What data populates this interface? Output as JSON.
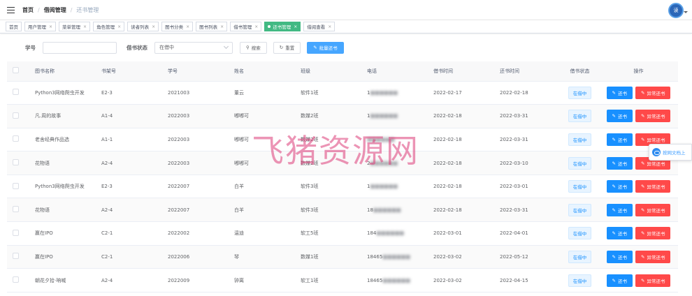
{
  "breadcrumb": [
    "首页",
    "借阅管理",
    "还书管理"
  ],
  "avatar_label": "读",
  "tabs": [
    {
      "label": "首页",
      "active": false,
      "closable": false
    },
    {
      "label": "用户管理",
      "active": false,
      "closable": true
    },
    {
      "label": "菜单管理",
      "active": false,
      "closable": true
    },
    {
      "label": "角色管理",
      "active": false,
      "closable": true
    },
    {
      "label": "读者列表",
      "active": false,
      "closable": true
    },
    {
      "label": "图书分类",
      "active": false,
      "closable": true
    },
    {
      "label": "图书列表",
      "active": false,
      "closable": true
    },
    {
      "label": "借书管理",
      "active": false,
      "closable": true
    },
    {
      "label": "还书管理",
      "active": true,
      "closable": true
    },
    {
      "label": "借阅查看",
      "active": false,
      "closable": true
    }
  ],
  "search": {
    "student_label": "学号",
    "student_value": "",
    "status_label": "借书状态",
    "status_value": "在借中",
    "search_btn": "搜索",
    "reset_btn": "重置",
    "batch_btn": "批量还书"
  },
  "table": {
    "headers": [
      "图书名称",
      "书架号",
      "学号",
      "姓名",
      "班级",
      "电话",
      "借书时间",
      "还书时间",
      "借书状态",
      "操作"
    ],
    "rows": [
      {
        "book": "Python3网络爬虫开发",
        "shelf": "E2-3",
        "sid": "2021003",
        "name": "董云",
        "class": "软件1班",
        "phone": "1",
        "borrow": "2022-02-17",
        "return": "2022-02-18",
        "status": "在借中"
      },
      {
        "book": "凡.周的故事",
        "shelf": "A1-4",
        "sid": "2022003",
        "name": "嘟嘟可",
        "class": "数媒2班",
        "phone": "1",
        "borrow": "2022-02-18",
        "return": "2022-03-31",
        "status": "在借中"
      },
      {
        "book": "老舍经典作品选",
        "shelf": "A1-1",
        "sid": "2022003",
        "name": "嘟嘟可",
        "class": "数媒2班",
        "phone": "",
        "borrow": "2022-02-18",
        "return": "2022-03-31",
        "status": "在借中"
      },
      {
        "book": "花物语",
        "shelf": "A2-4",
        "sid": "2022003",
        "name": "嘟嘟可",
        "class": "数媒2班",
        "phone": "2",
        "borrow": "2022-02-18",
        "return": "2022-03-10",
        "status": "在借中"
      },
      {
        "book": "Python3网络爬虫开发",
        "shelf": "E2-3",
        "sid": "2022007",
        "name": "白羊",
        "class": "软件3班",
        "phone": "1",
        "borrow": "2022-02-18",
        "return": "2022-03-01",
        "status": "在借中"
      },
      {
        "book": "花物语",
        "shelf": "A2-4",
        "sid": "2022007",
        "name": "白羊",
        "class": "软件3班",
        "phone": "18",
        "borrow": "2022-02-18",
        "return": "2022-03-31",
        "status": "在借中"
      },
      {
        "book": "赢在IPO",
        "shelf": "C2-1",
        "sid": "2022002",
        "name": "温迪",
        "class": "软工5班",
        "phone": "184",
        "borrow": "2022-03-01",
        "return": "2022-04-01",
        "status": "在借中"
      },
      {
        "book": "赢在IPO",
        "shelf": "C2-1",
        "sid": "2022006",
        "name": "琴",
        "class": "数媒1班",
        "phone": "18465",
        "borrow": "2022-03-02",
        "return": "2022-05-12",
        "status": "在借中"
      },
      {
        "book": "朝花夕拾·呐喊",
        "shelf": "A2-4",
        "sid": "2022009",
        "name": "钟离",
        "class": "软工1班",
        "phone": "18465",
        "borrow": "2022-03-02",
        "return": "2022-04-15",
        "status": "在借中"
      }
    ],
    "return_btn": "还书",
    "abnormal_btn": "异常还书"
  },
  "watermark": "飞猪资源网",
  "floater_label": "按网文档上"
}
